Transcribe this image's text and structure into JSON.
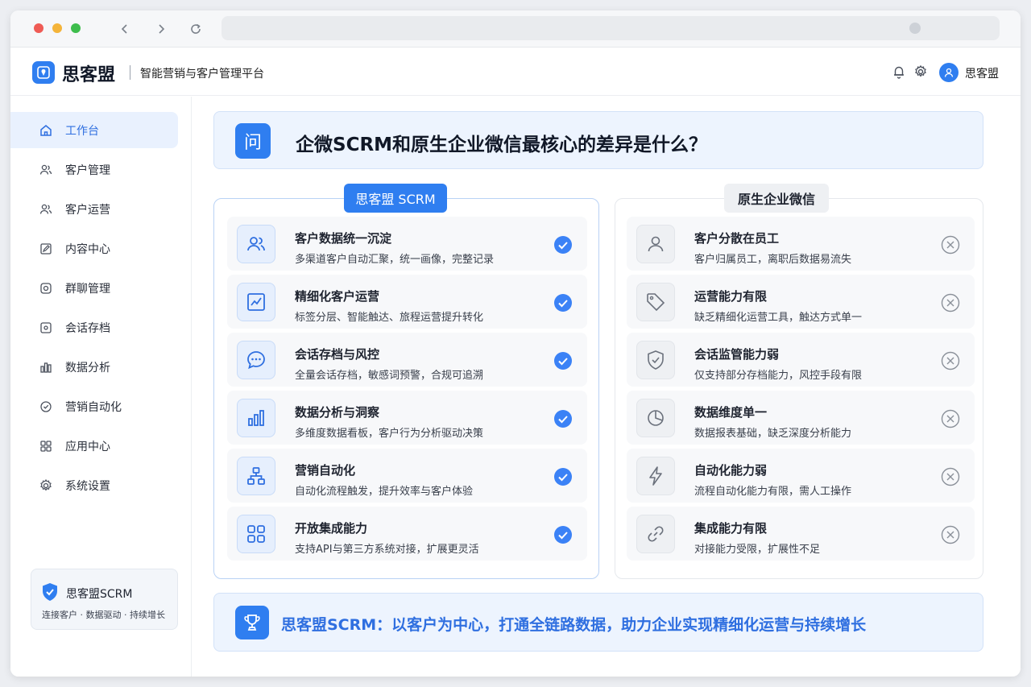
{
  "app": {
    "brand": "思客盟",
    "subtitle": "智能营销与客户管理平台",
    "user_name": "思客盟"
  },
  "sidebar": {
    "items": [
      {
        "label": "工作台",
        "icon": "home-icon",
        "active": true
      },
      {
        "label": "客户管理",
        "icon": "users-icon"
      },
      {
        "label": "客户运营",
        "icon": "user-group-icon"
      },
      {
        "label": "内容中心",
        "icon": "edit-doc-icon"
      },
      {
        "label": "群聊管理",
        "icon": "chat-group-icon"
      },
      {
        "label": "会话存档",
        "icon": "archive-icon"
      },
      {
        "label": "数据分析",
        "icon": "bar-chart-icon"
      },
      {
        "label": "营销自动化",
        "icon": "check-shield-icon"
      },
      {
        "label": "应用中心",
        "icon": "grid-icon"
      },
      {
        "label": "系统设置",
        "icon": "gear-icon"
      }
    ],
    "card": {
      "title": "思客盟SCRM",
      "subtitle": "连接客户 · 数据驱动 · 持续增长"
    }
  },
  "question": {
    "icon_char": "问",
    "text": "企微SCRM和原生企业微信最核心的差异是什么？"
  },
  "left_panel": {
    "title": "思客盟 SCRM",
    "rows": [
      {
        "title": "客户数据统一沉淀",
        "desc": "多渠道客户自动汇聚，统一画像，完整记录",
        "icon": "users-icon"
      },
      {
        "title": "精细化客户运营",
        "desc": "标签分层、智能触达、旅程运营提升转化",
        "icon": "trend-chart-icon"
      },
      {
        "title": "会话存档与风控",
        "desc": "全量会话存档，敏感词预警，合规可追溯",
        "icon": "chat-bubble-icon"
      },
      {
        "title": "数据分析与洞察",
        "desc": "多维度数据看板，客户行为分析驱动决策",
        "icon": "bar-chart-icon"
      },
      {
        "title": "营销自动化",
        "desc": "自动化流程触发，提升效率与客户体验",
        "icon": "flow-icon"
      },
      {
        "title": "开放集成能力",
        "desc": "支持API与第三方系统对接，扩展更灵活",
        "icon": "apps-grid-icon"
      }
    ]
  },
  "right_panel": {
    "title": "原生企业微信",
    "rows": [
      {
        "title": "客户分散在员工",
        "desc": "客户归属员工，离职后数据易流失",
        "icon": "person-icon"
      },
      {
        "title": "运营能力有限",
        "desc": "缺乏精细化运营工具，触达方式单一",
        "icon": "tag-icon"
      },
      {
        "title": "会话监管能力弱",
        "desc": "仅支持部分存档能力，风控手段有限",
        "icon": "shield-icon"
      },
      {
        "title": "数据维度单一",
        "desc": "数据报表基础，缺乏深度分析能力",
        "icon": "pie-chart-icon"
      },
      {
        "title": "自动化能力弱",
        "desc": "流程自动化能力有限，需人工操作",
        "icon": "lightning-icon"
      },
      {
        "title": "集成能力有限",
        "desc": "对接能力受限，扩展性不足",
        "icon": "link-icon"
      }
    ]
  },
  "banner": {
    "text": "思客盟SCRM：以客户为中心，打通全链路数据，助力企业实现精细化运营与持续增长"
  },
  "colors": {
    "accent": "#2f7ef0",
    "check": "#3b82f6",
    "cross": "#8a9099"
  }
}
